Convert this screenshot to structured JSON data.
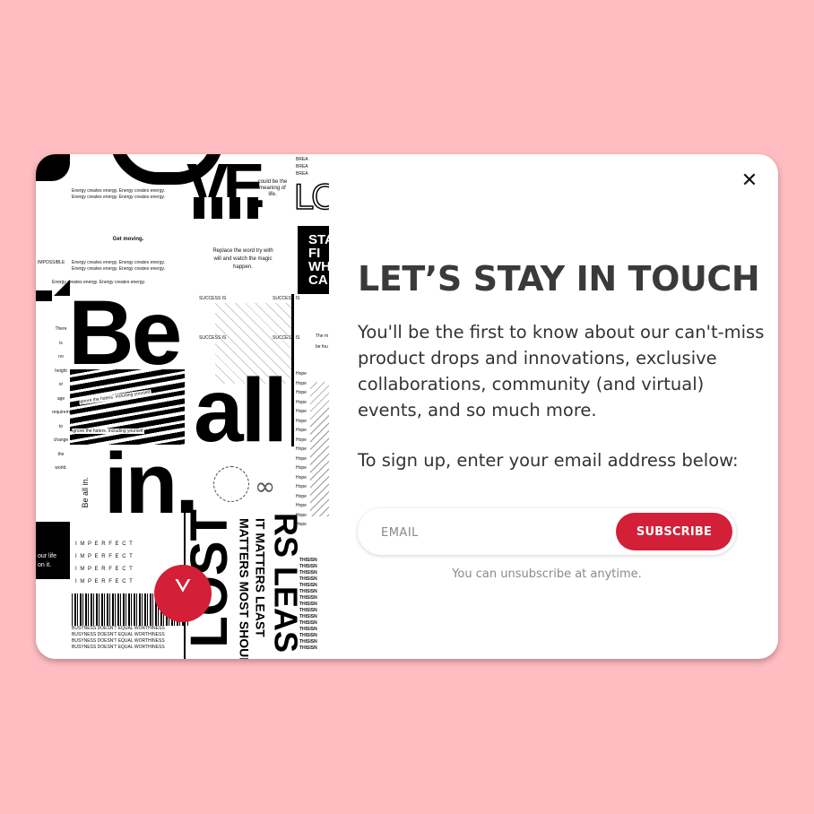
{
  "modal": {
    "close_symbol": "✕",
    "title": "LET’S STAY IN TOUCH",
    "description": "You'll be the first to know about our can't-miss product drops and innovations, exclusive collaborations, community (and virtual) events, and so much more.",
    "instruction": "To sign up, enter your email address below:",
    "email_placeholder": "EMAIL",
    "subscribe_label": "SUBSCRIBE",
    "unsubscribe_note": "You can unsubscribe at anytime."
  },
  "collage": {
    "be": "Be",
    "all": "all",
    "in": "in.",
    "get_moving": "Get moving.",
    "replace_word": "Replace the word try with will and watch the magic happen.",
    "could_be": "could be the meaning of life.",
    "energy_line": "Energy creates energy. Energy creates energy.",
    "impossible": "IMPOSSIBLE",
    "ignore_haters": "Ignore the haters. Including yourself.",
    "imperfect": "I M P E R F E C T",
    "success": "SUCCESS IS",
    "hope": "Hope",
    "busyness": "BUSYNESS DOESN'T EQUAL WORTHINESS",
    "this_is": "THISISN",
    "your_life": "our life",
    "on_it": "on it.",
    "be_all_in_small": "Be all in.",
    "vertical_words": [
      "There",
      "is",
      "no",
      "height",
      "or",
      "age",
      "requirement",
      "to",
      "change",
      "the",
      "world."
    ],
    "sta": "STA",
    "fi": "FI",
    "whi": "WHI",
    "ca": "CA",
    "lost": "LOST",
    "matters_most": "MATTERS MOST SHOULD",
    "matters_least": "IT MATTERS LEAST",
    "logo_symbol": "ᘁ"
  },
  "colors": {
    "background": "#ffbcc1",
    "accent": "#d31f37",
    "title": "#3a3a3c",
    "note": "#8a8a8a"
  },
  "icons": {
    "close": "close-icon",
    "logo": "lululemon-logo"
  }
}
